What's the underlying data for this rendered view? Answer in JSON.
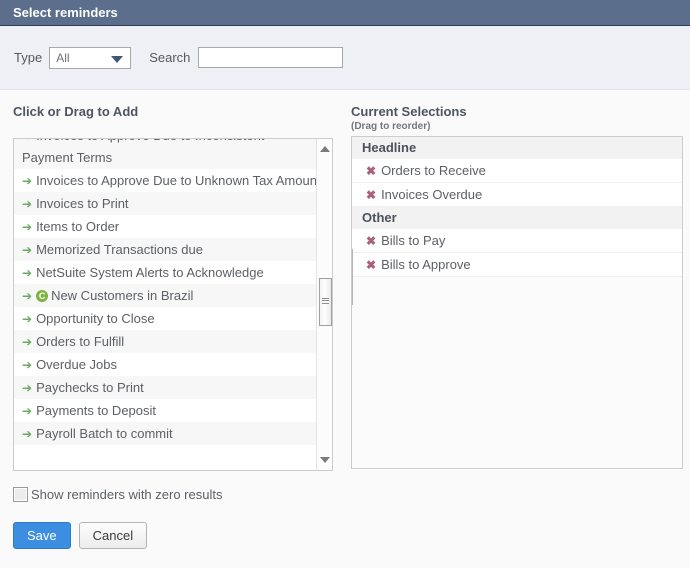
{
  "window": {
    "title": "Select reminders"
  },
  "filter": {
    "type_label": "Type",
    "type_value": "All",
    "type_options": [
      "All"
    ],
    "search_label": "Search",
    "search_value": "",
    "search_placeholder": ""
  },
  "available": {
    "heading": "Click or Drag to Add",
    "items": [
      {
        "label": "Invoices to Approve Due to Inconsistent Payment Terms",
        "two_line": true,
        "badge": null
      },
      {
        "label": "Invoices to Approve Due to Unknown Tax Amount",
        "two_line": false,
        "badge": null
      },
      {
        "label": "Invoices to Print",
        "two_line": false,
        "badge": null
      },
      {
        "label": "Items to Order",
        "two_line": false,
        "badge": null
      },
      {
        "label": "Memorized Transactions due",
        "two_line": false,
        "badge": null
      },
      {
        "label": "NetSuite System Alerts to Acknowledge",
        "two_line": false,
        "badge": null
      },
      {
        "label": "New Customers in Brazil",
        "two_line": false,
        "badge": "C"
      },
      {
        "label": "Opportunity to Close",
        "two_line": false,
        "badge": null
      },
      {
        "label": "Orders to Fulfill",
        "two_line": false,
        "badge": null
      },
      {
        "label": "Overdue Jobs",
        "two_line": false,
        "badge": null
      },
      {
        "label": "Paychecks to Print",
        "two_line": false,
        "badge": null
      },
      {
        "label": "Payments to Deposit",
        "two_line": false,
        "badge": null
      },
      {
        "label": "Payroll Batch to commit",
        "two_line": false,
        "badge": null
      }
    ],
    "add_icon": "add-arrow-icon",
    "scrollbar": {
      "up_icon": "scroll-up-arrow-icon",
      "down_icon": "scroll-down-arrow-icon"
    }
  },
  "selections": {
    "heading": "Current Selections",
    "subheading": "(Drag to reorder)",
    "groups": [
      {
        "name": "Headline",
        "items": [
          {
            "label": "Orders to Receive"
          },
          {
            "label": "Invoices Overdue"
          }
        ]
      },
      {
        "name": "Other",
        "items": [
          {
            "label": "Bills to Pay"
          },
          {
            "label": "Bills to Approve"
          }
        ]
      }
    ],
    "remove_icon": "remove-x-icon"
  },
  "options": {
    "zero_results_label": "Show reminders with zero results",
    "zero_results_checked": false
  },
  "actions": {
    "save_label": "Save",
    "cancel_label": "Cancel"
  },
  "colors": {
    "titlebar": "#5b6e8c",
    "filterbar": "#eef0f5",
    "add_arrow": "#6aab63",
    "badge": "#7cb342",
    "remove_x": "#a8617c",
    "save_button": "#3c8ee0"
  }
}
